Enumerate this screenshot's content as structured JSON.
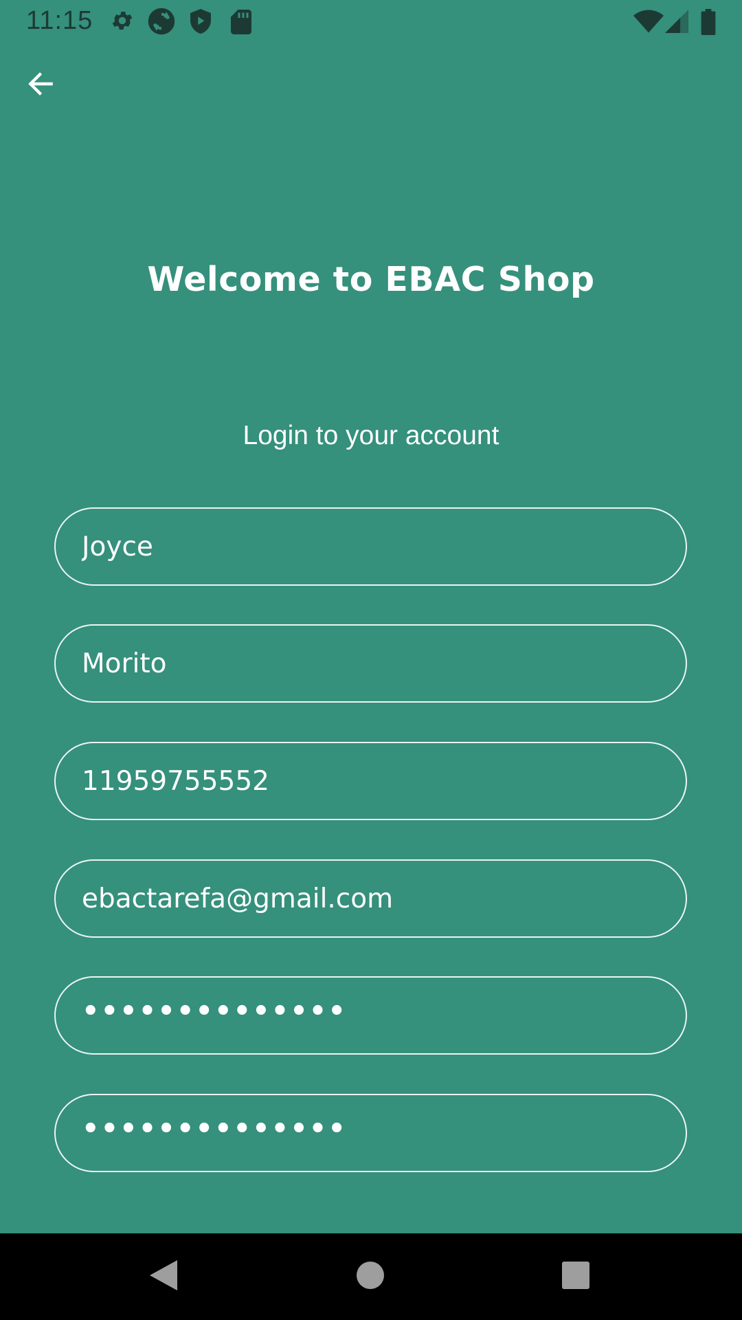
{
  "status_bar": {
    "time": "11:15",
    "icons": [
      "settings-icon",
      "sync-icon",
      "shield-play-icon",
      "sd-card-icon",
      "wifi-icon",
      "signal-icon",
      "battery-icon"
    ]
  },
  "header": {
    "back_icon": "arrow-left-icon"
  },
  "main": {
    "title": "Welcome to EBAC Shop",
    "subtitle": "Login to your account",
    "fields": [
      {
        "value": "Joyce"
      },
      {
        "value": "Morito"
      },
      {
        "value": "11959755552"
      },
      {
        "value": "ebactarefa@gmail.com"
      },
      {
        "value": "••••••••••••••"
      },
      {
        "value": "••••••••••••••"
      }
    ]
  },
  "nav_bar": {
    "buttons": [
      "back-triangle-icon",
      "home-circle-icon",
      "recents-square-icon"
    ]
  },
  "colors": {
    "background": "#35907c",
    "status_icons": "#1c3a33",
    "text": "#ffffff",
    "nav_background": "#000000",
    "nav_icons": "#9e9e9e"
  }
}
